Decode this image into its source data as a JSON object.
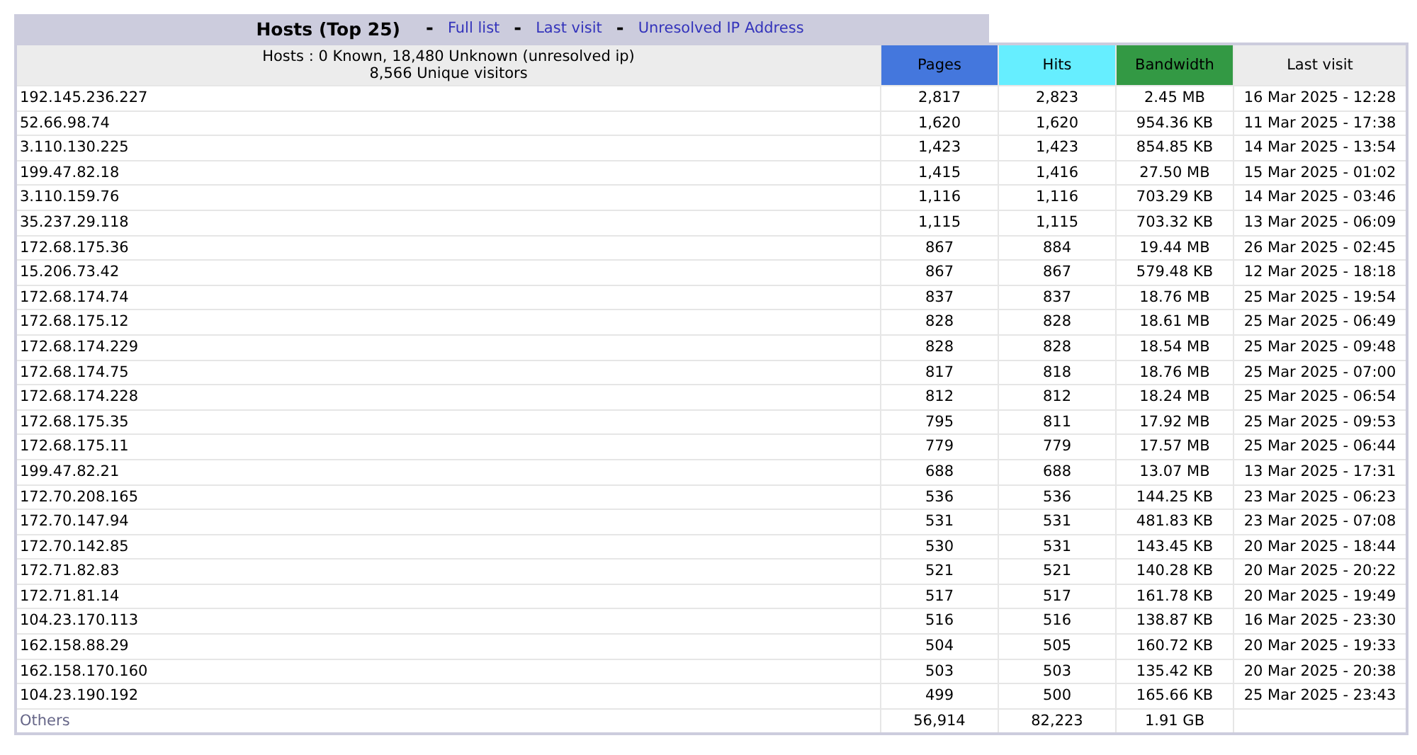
{
  "section": {
    "title": "Hosts (Top 25)",
    "nav": [
      {
        "kind": "separator",
        "text": "-"
      },
      {
        "kind": "link",
        "text": "Full list"
      },
      {
        "kind": "separator",
        "text": "-"
      },
      {
        "kind": "link",
        "text": "Last visit"
      },
      {
        "kind": "separator",
        "text": "-"
      },
      {
        "kind": "link",
        "text": "Unresolved IP Address"
      }
    ]
  },
  "table": {
    "columns": [
      {
        "label": "Hosts : 0 Known, 18,480 Unknown (unresolved ip)",
        "sublabel": "8,566 Unique visitors",
        "color": "#ececec"
      },
      {
        "label": "Pages",
        "color": "#4477dd"
      },
      {
        "label": "Hits",
        "color": "#66eeff"
      },
      {
        "label": "Bandwidth",
        "color": "#339944"
      },
      {
        "label": "Last visit",
        "color": "#ececec"
      }
    ],
    "rows": [
      [
        "192.145.236.227",
        "2,817",
        "2,823",
        "2.45 MB",
        "16 Mar 2025 - 12:28"
      ],
      [
        "52.66.98.74",
        "1,620",
        "1,620",
        "954.36 KB",
        "11 Mar 2025 - 17:38"
      ],
      [
        "3.110.130.225",
        "1,423",
        "1,423",
        "854.85 KB",
        "14 Mar 2025 - 13:54"
      ],
      [
        "199.47.82.18",
        "1,415",
        "1,416",
        "27.50 MB",
        "15 Mar 2025 - 01:02"
      ],
      [
        "3.110.159.76",
        "1,116",
        "1,116",
        "703.29 KB",
        "14 Mar 2025 - 03:46"
      ],
      [
        "35.237.29.118",
        "1,115",
        "1,115",
        "703.32 KB",
        "13 Mar 2025 - 06:09"
      ],
      [
        "172.68.175.36",
        "867",
        "884",
        "19.44 MB",
        "26 Mar 2025 - 02:45"
      ],
      [
        "15.206.73.42",
        "867",
        "867",
        "579.48 KB",
        "12 Mar 2025 - 18:18"
      ],
      [
        "172.68.174.74",
        "837",
        "837",
        "18.76 MB",
        "25 Mar 2025 - 19:54"
      ],
      [
        "172.68.175.12",
        "828",
        "828",
        "18.61 MB",
        "25 Mar 2025 - 06:49"
      ],
      [
        "172.68.174.229",
        "828",
        "828",
        "18.54 MB",
        "25 Mar 2025 - 09:48"
      ],
      [
        "172.68.174.75",
        "817",
        "818",
        "18.76 MB",
        "25 Mar 2025 - 07:00"
      ],
      [
        "172.68.174.228",
        "812",
        "812",
        "18.24 MB",
        "25 Mar 2025 - 06:54"
      ],
      [
        "172.68.175.35",
        "795",
        "811",
        "17.92 MB",
        "25 Mar 2025 - 09:53"
      ],
      [
        "172.68.175.11",
        "779",
        "779",
        "17.57 MB",
        "25 Mar 2025 - 06:44"
      ],
      [
        "199.47.82.21",
        "688",
        "688",
        "13.07 MB",
        "13 Mar 2025 - 17:31"
      ],
      [
        "172.70.208.165",
        "536",
        "536",
        "144.25 KB",
        "23 Mar 2025 - 06:23"
      ],
      [
        "172.70.147.94",
        "531",
        "531",
        "481.83 KB",
        "23 Mar 2025 - 07:08"
      ],
      [
        "172.70.142.85",
        "530",
        "531",
        "143.45 KB",
        "20 Mar 2025 - 18:44"
      ],
      [
        "172.71.82.83",
        "521",
        "521",
        "140.28 KB",
        "20 Mar 2025 - 20:22"
      ],
      [
        "172.71.81.14",
        "517",
        "517",
        "161.78 KB",
        "20 Mar 2025 - 19:49"
      ],
      [
        "104.23.170.113",
        "516",
        "516",
        "138.87 KB",
        "16 Mar 2025 - 23:30"
      ],
      [
        "162.158.88.29",
        "504",
        "505",
        "160.72 KB",
        "20 Mar 2025 - 19:33"
      ],
      [
        "162.158.170.160",
        "503",
        "503",
        "135.42 KB",
        "20 Mar 2025 - 20:38"
      ],
      [
        "104.23.190.192",
        "499",
        "500",
        "165.66 KB",
        "25 Mar 2025 - 23:43"
      ]
    ],
    "others": [
      "Others",
      "56,914",
      "82,223",
      "1.91 GB"
    ]
  }
}
